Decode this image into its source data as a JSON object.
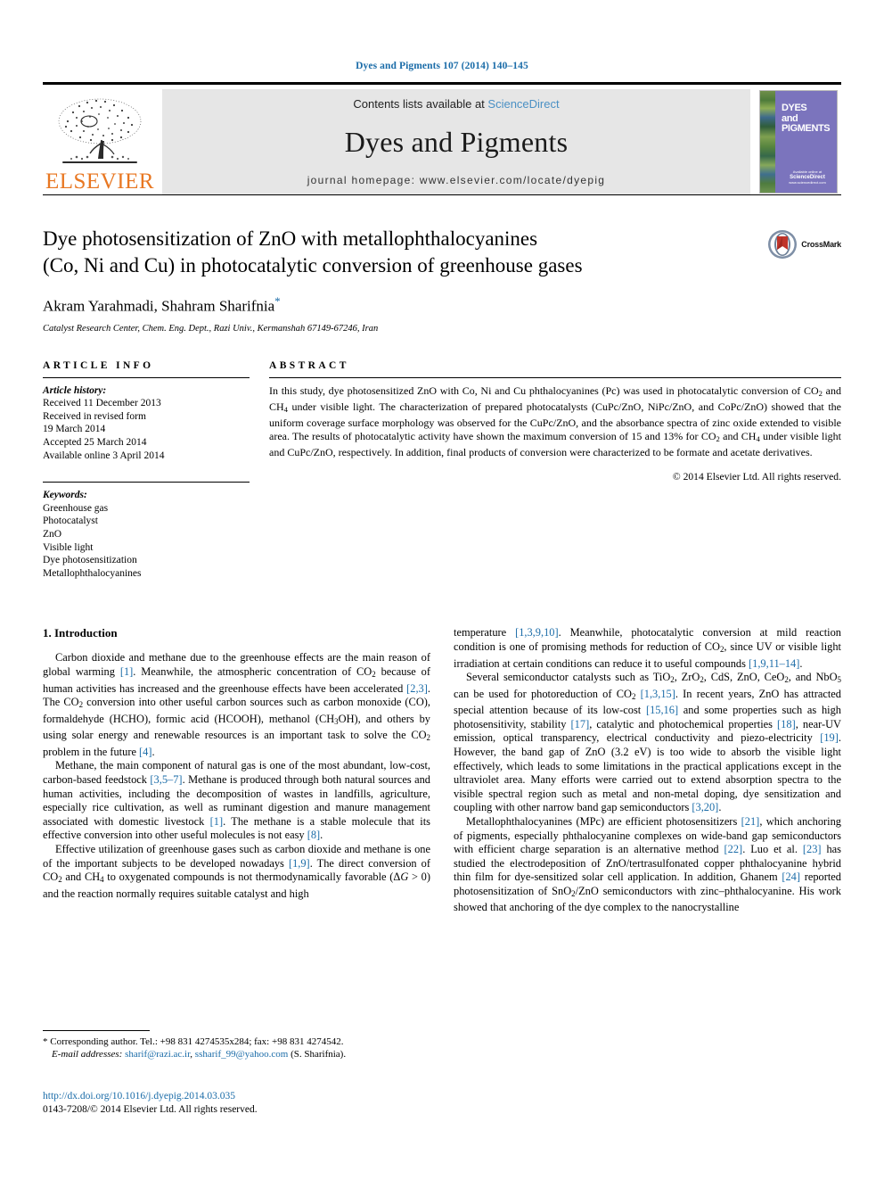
{
  "running_head": "Dyes and Pigments 107 (2014) 140–145",
  "masthead": {
    "publisher_name": "ELSEVIER",
    "contents_prefix": "Contents lists available at ",
    "contents_link": "ScienceDirect",
    "journal_name": "Dyes and Pigments",
    "homepage": "journal homepage: www.elsevier.com/locate/dyepig",
    "cover_title_line1": "DYES",
    "cover_title_line2": "and",
    "cover_title_line3": "PIGMENTS",
    "cover_footer_top": "Available online at",
    "cover_footer_brand": "ScienceDirect",
    "cover_footer_url": "www.sciencedirect.com"
  },
  "title": {
    "line1": "Dye photosensitization of ZnO with metallophthalocyanines",
    "line2": "(Co, Ni and Cu) in photocatalytic conversion of greenhouse gases",
    "authors": "Akram Yarahmadi, Shahram Sharifnia",
    "corresponding_marker": "*",
    "affiliation": "Catalyst Research Center, Chem. Eng. Dept., Razi Univ., Kermanshah 67149-67246, Iran",
    "crossmark_label": "CrossMark"
  },
  "article_info": {
    "heading": "ARTICLE INFO",
    "history_label": "Article history:",
    "history": [
      "Received 11 December 2013",
      "Received in revised form",
      "19 March 2014",
      "Accepted 25 March 2014",
      "Available online 3 April 2014"
    ],
    "keywords_label": "Keywords:",
    "keywords": [
      "Greenhouse gas",
      "Photocatalyst",
      "ZnO",
      "Visible light",
      "Dye photosensitization",
      "Metallophthalocyanines"
    ]
  },
  "abstract": {
    "heading": "ABSTRACT",
    "paragraphs": [
      "In this study, dye photosensitized ZnO with Co, Ni and Cu phthalocyanines (Pc) was used in photocatalytic conversion of CO2 and CH4 under visible light. The characterization of prepared photocatalysts (CuPc/ZnO, NiPc/ZnO, and CoPc/ZnO) showed that the uniform coverage surface morphology was observed for the CuPc/ZnO, and the absorbance spectra of zinc oxide extended to visible area. The results of photocatalytic activity have shown the maximum conversion of 15 and 13% for CO2 and CH4 under visible light and CuPc/ZnO, respectively. In addition, final products of conversion were characterized to be formate and acetate derivatives."
    ],
    "copyright": "© 2014 Elsevier Ltd. All rights reserved."
  },
  "body": {
    "section1_heading": "1. Introduction",
    "left_paragraphs": [
      "Carbon dioxide and methane due to the greenhouse effects are the main reason of global warming [1]. Meanwhile, the atmospheric concentration of CO2 because of human activities has increased and the greenhouse effects have been accelerated [2,3]. The CO2 conversion into other useful carbon sources such as carbon monoxide (CO), formaldehyde (HCHO), formic acid (HCOOH), methanol (CH3OH), and others by using solar energy and renewable resources is an important task to solve the CO2 problem in the future [4].",
      "Methane, the main component of natural gas is one of the most abundant, low-cost, carbon-based feedstock [3,5–7]. Methane is produced through both natural sources and human activities, including the decomposition of wastes in landfills, agriculture, especially rice cultivation, as well as ruminant digestion and manure management associated with domestic livestock [1]. The methane is a stable molecule that its effective conversion into other useful molecules is not easy [8].",
      "Effective utilization of greenhouse gases such as carbon dioxide and methane is one of the important subjects to be developed nowadays [1,9]. The direct conversion of CO2 and CH4 to oxygenated compounds is not thermodynamically favorable (ΔG > 0) and the reaction normally requires suitable catalyst and high"
    ],
    "right_paragraphs": [
      "temperature [1,3,9,10]. Meanwhile, photocatalytic conversion at mild reaction condition is one of promising methods for reduction of CO2, since UV or visible light irradiation at certain conditions can reduce it to useful compounds [1,9,11–14].",
      "Several semiconductor catalysts such as TiO2, ZrO2, CdS, ZnO, CeO2, and NbO5 can be used for photoreduction of CO2 [1,3,15]. In recent years, ZnO has attracted special attention because of its low-cost [15,16] and some properties such as high photosensitivity, stability [17], catalytic and photochemical properties [18], near-UV emission, optical transparency, electrical conductivity and piezo-electricity [19]. However, the band gap of ZnO (3.2 eV) is too wide to absorb the visible light effectively, which leads to some limitations in the practical applications except in the ultraviolet area. Many efforts were carried out to extend absorption spectra to the visible spectral region such as metal and non-metal doping, dye sensitization and coupling with other narrow band gap semiconductors [3,20].",
      "Metallophthalocyanines (MPc) are efficient photosensitizers [21], which anchoring of pigments, especially phthalocyanine complexes on wide-band gap semiconductors with efficient charge separation is an alternative method [22]. Luo et al. [23] has studied the electrodeposition of ZnO/tertrasulfonated copper phthalocyanine hybrid thin film for dye-sensitized solar cell application. In addition, Ghanem [24] reported photosensitization of SnO2/ZnO semiconductors with zinc–phthalocyanine. His work showed that anchoring of the dye complex to the nanocrystalline"
    ]
  },
  "footnote": {
    "corresponding": "* Corresponding author. Tel.: +98 831 4274535x284; fax: +98 831 4274542.",
    "email_label": "E-mail addresses:",
    "email1": "sharif@razi.ac.ir",
    "email2": "ssharif_99@yahoo.com",
    "email_suffix": "(S. Sharifnia).",
    "doi": "http://dx.doi.org/10.1016/j.dyepig.2014.03.035",
    "issn_line": "0143-7208/© 2014 Elsevier Ltd. All rights reserved."
  },
  "colors": {
    "link_blue": "#1b6ca8",
    "elsevier_orange": "#e87722",
    "band_gray": "#e6e6e6",
    "cover_purple": "#7b74bd",
    "crossmark_red": "#c0352b"
  }
}
